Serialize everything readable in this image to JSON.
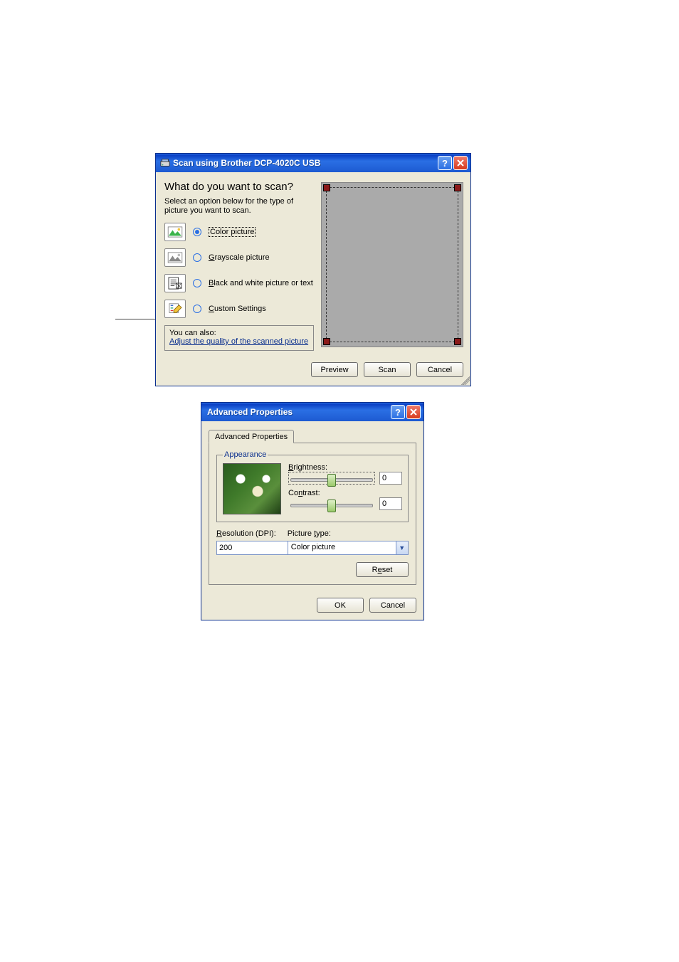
{
  "scan_dialog": {
    "title": "Scan using Brother DCP-4020C USB",
    "heading": "What do you want to scan?",
    "subtext": "Select an option below for the type of picture you want to scan.",
    "options": {
      "color": {
        "label": "Color picture",
        "checked": true
      },
      "gray": {
        "label": "Grayscale picture",
        "checked": false
      },
      "bw": {
        "label": "Black and white picture or text",
        "checked": false
      },
      "custom": {
        "label": "Custom Settings",
        "checked": false
      }
    },
    "you_can_also": "You can also:",
    "adjust_link": "Adjust the quality of the scanned picture",
    "buttons": {
      "preview": "Preview",
      "scan": "Scan",
      "cancel": "Cancel"
    }
  },
  "adv_dialog": {
    "title": "Advanced Properties",
    "tab": "Advanced Properties",
    "appearance_legend": "Appearance",
    "brightness_label": "Brightness:",
    "brightness_value": "0",
    "contrast_label": "Contrast:",
    "contrast_value": "0",
    "resolution_label": "Resolution (DPI):",
    "resolution_value": "200",
    "picture_type_label": "Picture type:",
    "picture_type_value": "Color picture",
    "reset": "Reset",
    "ok": "OK",
    "cancel": "Cancel"
  }
}
